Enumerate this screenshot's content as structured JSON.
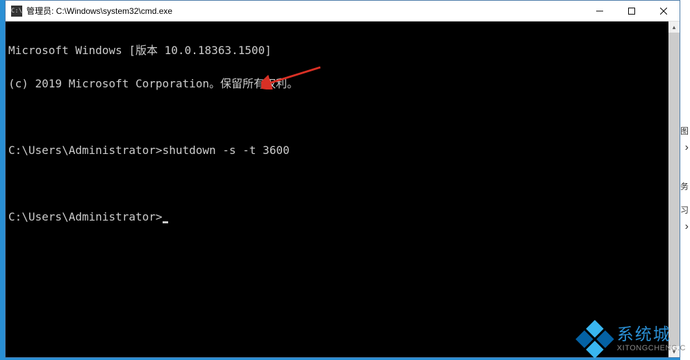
{
  "window": {
    "title": "管理员: C:\\Windows\\system32\\cmd.exe",
    "icon_label": "C:\\"
  },
  "terminal": {
    "line1": "Microsoft Windows [版本 10.0.18363.1500]",
    "line2": "(c) 2019 Microsoft Corporation。保留所有权利。",
    "blank1": "",
    "prompt1": "C:\\Users\\Administrator>",
    "command1": "shutdown -s -t 3600",
    "blank2": "",
    "prompt2": "C:\\Users\\Administrator>"
  },
  "bg": {
    "item1": "图",
    "item2": "务",
    "item3": "习",
    "arrow1": "›",
    "arrow2": "›"
  },
  "watermark": {
    "cn": "系统城",
    "url": "XITONGCHENG.C",
    "colors": {
      "light": "#39b6f0",
      "dark": "#0462a4"
    }
  },
  "colors": {
    "arrow": "#d93025"
  }
}
